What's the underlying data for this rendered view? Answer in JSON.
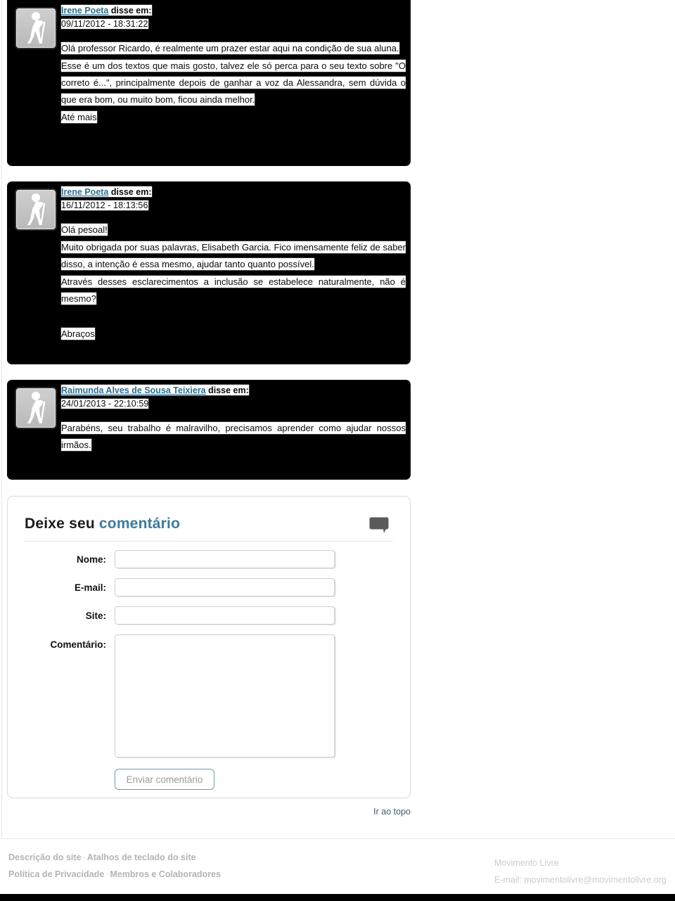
{
  "comments": [
    {
      "author": "Irene Poeta",
      "said_label": "disse em:",
      "date": "09/11/2012 - 18:31:22",
      "avatar_icon": "blind-person-walking-icon",
      "paragraphs": [
        "Olá professor Ricardo, é realmente um prazer estar aqui na condição de sua aluna.",
        "Esse é um dos textos que mais gosto, talvez ele só perca para o seu texto sobre \"O correto é...\", principalmente depois de ganhar a voz da Alessandra, sem dúvida o que era bom, ou muito bom, ficou ainda melhor.",
        "Até mais"
      ]
    },
    {
      "author": "Irene Poeta",
      "said_label": "disse em:",
      "date": "16/11/2012 - 18:13:56",
      "avatar_icon": "blind-person-walking-icon",
      "paragraphs": [
        "Olá pesoal!",
        "Muito obrigada por suas palavras, Elisabeth Garcia. Fico imensamente feliz de saber disso, a intenção é essa mesmo, ajudar tanto quanto possível.",
        "Através desses esclarecimentos a inclusão se estabelece naturalmente, não é mesmo?",
        "",
        "Abraços"
      ]
    },
    {
      "author": "Raimunda Alves de Sousa Teixiera",
      "said_label": "disse em:",
      "date": "24/01/2013 - 22:10:59",
      "avatar_icon": "blind-person-walking-icon",
      "paragraphs": [
        "Parabéns, seu trabalho é malravilho, precisamos aprender como ajudar nossos irmãos."
      ]
    }
  ],
  "form": {
    "title_plain": "Deixe seu ",
    "title_accent": "comentário",
    "bubble_icon": "speech-bubble-icon",
    "fields": [
      {
        "label": "Nome:",
        "value": "",
        "placeholder": ""
      },
      {
        "label": "E-mail:",
        "value": "",
        "placeholder": ""
      },
      {
        "label": "Site:",
        "value": "",
        "placeholder": ""
      }
    ],
    "comment_label": "Comentário:",
    "comment_value": "",
    "comment_placeholder": "",
    "submit_label": "Enviar comentário"
  },
  "to_top_label": "Ir ao topo",
  "footer": {
    "links": [
      "Descrição do site",
      "Atalhos de teclado do site",
      "Política de Privacidade",
      "Membros e Colaboradores"
    ],
    "separator": "·",
    "org_name": "Movimento Livre",
    "org_email": "E-mail: movimentolivre@movimentolivre.org"
  },
  "colors": {
    "card_bg": "#000000",
    "author_link": "#2d6e8e",
    "accent": "#3a7c9b",
    "submit_border": "#6e9daa",
    "footer_text": "#b4b4b4",
    "selection_bg": "#ffffff"
  }
}
